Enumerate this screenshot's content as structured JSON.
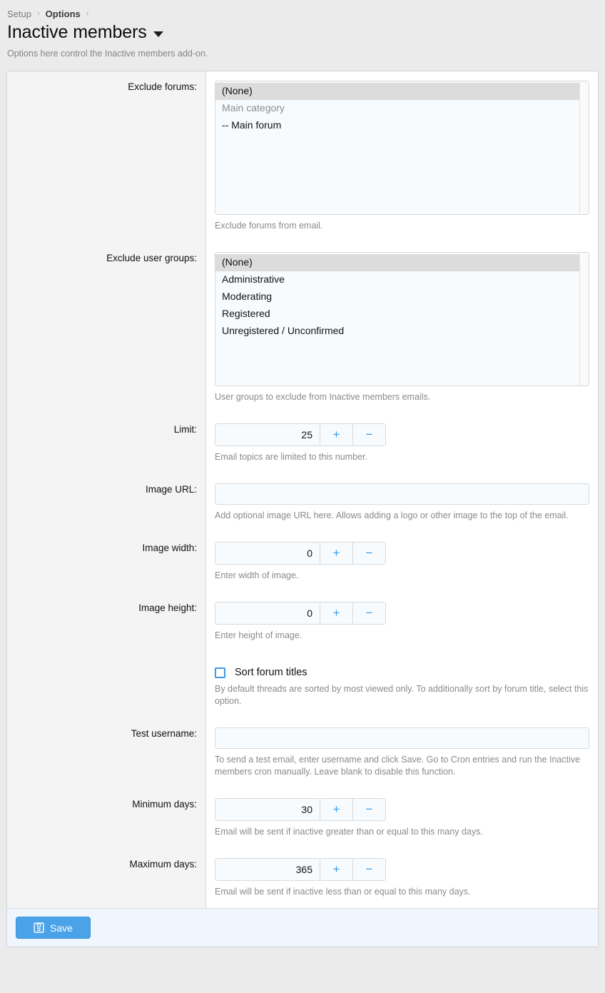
{
  "breadcrumb": {
    "items": [
      {
        "label": "Setup",
        "current": false
      },
      {
        "label": "Options",
        "current": true
      }
    ],
    "separator": "›"
  },
  "header": {
    "title": "Inactive members",
    "subtitle": "Options here control the Inactive members add-on."
  },
  "form": {
    "exclude_forums": {
      "label": "Exclude forums:",
      "options": [
        {
          "text": "(None)",
          "selected": true,
          "disabled": false
        },
        {
          "text": "Main category",
          "selected": false,
          "disabled": true
        },
        {
          "text": "-- Main forum",
          "selected": false,
          "disabled": false
        }
      ],
      "explain": "Exclude forums from email."
    },
    "exclude_user_groups": {
      "label": "Exclude user groups:",
      "options": [
        {
          "text": "(None)",
          "selected": true,
          "disabled": false
        },
        {
          "text": "Administrative",
          "selected": false,
          "disabled": false
        },
        {
          "text": "Moderating",
          "selected": false,
          "disabled": false
        },
        {
          "text": "Registered",
          "selected": false,
          "disabled": false
        },
        {
          "text": "Unregistered / Unconfirmed",
          "selected": false,
          "disabled": false
        }
      ],
      "explain": "User groups to exclude from Inactive members emails."
    },
    "limit": {
      "label": "Limit:",
      "value": "25",
      "explain": "Email topics are limited to this number."
    },
    "image_url": {
      "label": "Image URL:",
      "value": "",
      "placeholder": "",
      "explain": "Add optional image URL here. Allows adding a logo or other image to the top of the email."
    },
    "image_width": {
      "label": "Image width:",
      "value": "0",
      "explain": "Enter width of image."
    },
    "image_height": {
      "label": "Image height:",
      "value": "0",
      "explain": "Enter height of image."
    },
    "sort_forum_titles": {
      "label": "Sort forum titles",
      "checked": false,
      "explain": "By default threads are sorted by most viewed only. To additionally sort by forum title, select this option."
    },
    "test_username": {
      "label": "Test username:",
      "value": "",
      "placeholder": "",
      "explain": "To send a test email, enter username and click Save. Go to Cron entries and run the Inactive members cron manually. Leave blank to disable this function."
    },
    "minimum_days": {
      "label": "Minimum days:",
      "value": "30",
      "explain": "Email will be sent if inactive greater than or equal to this many days."
    },
    "maximum_days": {
      "label": "Maximum days:",
      "value": "365",
      "explain": "Email will be sent if inactive less than or equal to this many days."
    },
    "stepper": {
      "increment_label": "+",
      "decrement_label": "−"
    }
  },
  "footer": {
    "save_label": "Save",
    "save_icon": "save-floppy-icon"
  },
  "colors": {
    "accent": "#4aa3e8",
    "stepper_symbol": "#2f9bf0",
    "checkbox_border": "#3c9ae8",
    "input_bg": "#f7fbfe",
    "label_col_bg": "#f4f4f4",
    "footer_bg": "#eff6fd",
    "page_bg": "#ebebeb"
  }
}
